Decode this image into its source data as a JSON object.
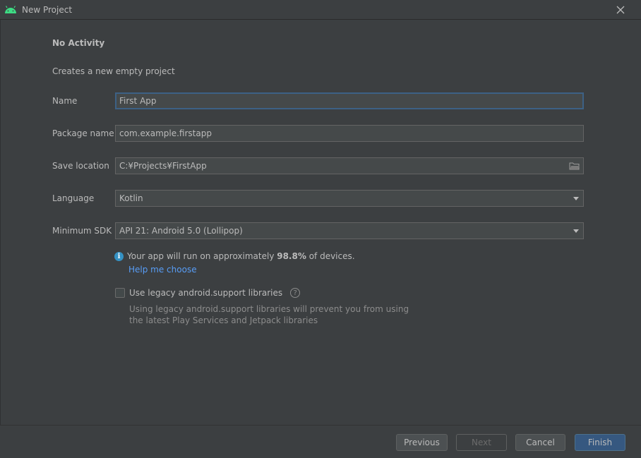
{
  "window": {
    "title": "New Project",
    "logo_icon": "android-icon",
    "close_icon": "close-icon"
  },
  "template": {
    "heading": "No Activity",
    "description": "Creates a new empty project"
  },
  "form": {
    "name": {
      "label": "Name",
      "value": "First App"
    },
    "package": {
      "label": "Package name",
      "value": "com.example.firstapp"
    },
    "location": {
      "label": "Save location",
      "value": "C:¥Projects¥FirstApp",
      "icon": "folder-icon"
    },
    "language": {
      "label": "Language",
      "value": "Kotlin"
    },
    "min_sdk": {
      "label": "Minimum SDK",
      "value": "API 21: Android 5.0 (Lollipop)"
    }
  },
  "info": {
    "prefix": "Your app will run on approximately ",
    "percent": "98.8%",
    "suffix": " of devices.",
    "help_link": "Help me choose"
  },
  "legacy": {
    "label": "Use legacy android.support libraries",
    "checked": false,
    "note_line1": "Using legacy android.support libraries will prevent you from using",
    "note_line2": "the latest Play Services and Jetpack libraries"
  },
  "buttons": {
    "previous": "Previous",
    "next": "Next",
    "cancel": "Cancel",
    "finish": "Finish"
  },
  "colors": {
    "background": "#3c3f41",
    "field_bg": "#45494a",
    "focus_border": "#3d6185",
    "link": "#589df6",
    "info_icon": "#3592c4",
    "primary_button": "#365880",
    "android_green": "#3ddc84"
  }
}
